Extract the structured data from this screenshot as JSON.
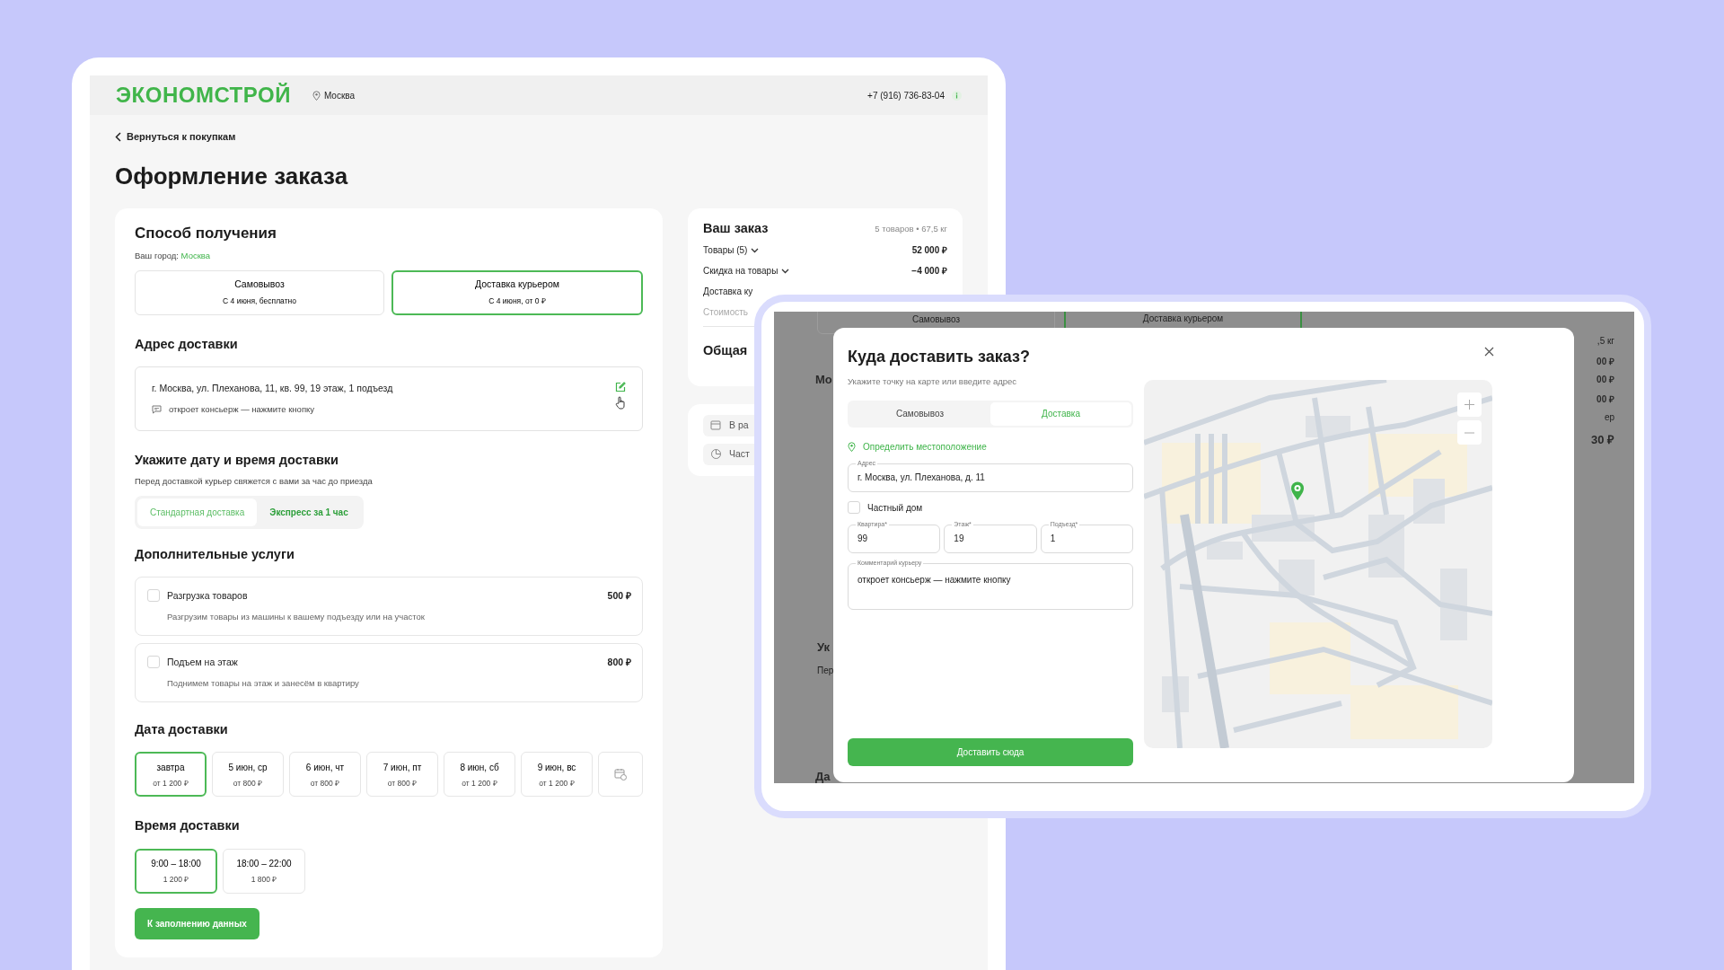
{
  "header": {
    "logo": "ЭКОНОМСТРОЙ",
    "city": "Москва",
    "phone": "+7 (916) 736-83-04"
  },
  "back_link": "Вернуться к покупкам",
  "page_title": "Оформление заказа",
  "receipt": {
    "title": "Способ получения",
    "city_label": "Ваш город:",
    "city": "Москва",
    "options": [
      {
        "title": "Самовывоз",
        "subtitle": "С 4 июня, бесплатно",
        "selected": false
      },
      {
        "title": "Доставка курьером",
        "subtitle": "С 4 июня, от 0 ₽",
        "selected": true
      }
    ]
  },
  "address": {
    "title": "Адрес доставки",
    "value": "г. Москва, ул. Плеханова, 11, кв. 99, 19 этаж, 1 подъезд",
    "comment": "откроет консьерж — нажмите кнопку"
  },
  "schedule": {
    "title": "Укажите дату и время доставки",
    "subtitle": "Перед доставкой курьер свяжется с вами за час до приезда",
    "modes": [
      {
        "label": "Стандартная доставка",
        "selected": true
      },
      {
        "label": "Экспресс за 1 час",
        "selected": false
      }
    ]
  },
  "services": {
    "title": "Дополнительные услуги",
    "items": [
      {
        "name": "Разгрузка товаров",
        "description": "Разгрузим товары из машины к вашему подъезду или на участок",
        "price": "500 ₽",
        "checked": false
      },
      {
        "name": "Подъем на этаж",
        "description": "Поднимем товары на этаж и занесём в квартиру",
        "price": "800 ₽",
        "checked": false
      }
    ]
  },
  "dates": {
    "title": "Дата доставки",
    "items": [
      {
        "day": "завтра",
        "price": "от 1 200 ₽",
        "selected": true
      },
      {
        "day": "5 июн, ср",
        "price": "от 800 ₽",
        "selected": false
      },
      {
        "day": "6 июн, чт",
        "price": "от 800 ₽",
        "selected": false
      },
      {
        "day": "7 июн, пт",
        "price": "от 800 ₽",
        "selected": false
      },
      {
        "day": "8 июн, сб",
        "price": "от 1 200 ₽",
        "selected": false
      },
      {
        "day": "9 июн, вс",
        "price": "от 1 200 ₽",
        "selected": false
      }
    ]
  },
  "times": {
    "title": "Время доставки",
    "items": [
      {
        "range": "9:00 – 18:00",
        "price": "1 200 ₽",
        "selected": true
      },
      {
        "range": "18:00 – 22:00",
        "price": "1 800 ₽",
        "selected": false
      }
    ]
  },
  "next_button": "К заполнению данных",
  "summary": {
    "title": "Ваш заказ",
    "meta": "5 товаров • 67,5 кг",
    "rows": [
      {
        "label": "Товары (5)",
        "value": "52 000 ₽",
        "expandable": true,
        "muted": false
      },
      {
        "label": "Скидка на товары",
        "value": "−4 000 ₽",
        "expandable": true,
        "muted": false
      },
      {
        "label": "Доставка ку",
        "expandable": false,
        "muted": false
      },
      {
        "label": "Стоимость",
        "expandable": false,
        "muted": true
      }
    ],
    "total_label": "Общая"
  },
  "extras": [
    {
      "kind": "calendar",
      "label": "В ра"
    },
    {
      "kind": "chart",
      "label": "Част"
    }
  ],
  "backdrop": {
    "texts": [
      {
        "kind": "option",
        "text": "Самовывоз",
        "selected": false
      },
      {
        "kind": "option",
        "text": "Доставка курьером",
        "selected": true
      },
      {
        "kind": "heading",
        "text": "Мо"
      },
      {
        "kind": "heading",
        "text": "Ук"
      },
      {
        "kind": "note",
        "text": "Пер"
      },
      {
        "kind": "heading",
        "text": "Да"
      },
      {
        "kind": "note",
        "text": ",5 кг"
      },
      {
        "kind": "value",
        "text": "00 ₽"
      },
      {
        "kind": "value",
        "text": "00 ₽"
      },
      {
        "kind": "value",
        "text": "00 ₽"
      },
      {
        "kind": "note",
        "text": "ер"
      },
      {
        "kind": "total",
        "text": "30 ₽"
      }
    ]
  },
  "modal": {
    "title": "Куда доставить заказ?",
    "subtitle": "Укажите точку на карте или введите адрес",
    "tabs": [
      {
        "label": "Самовывоз",
        "selected": false
      },
      {
        "label": "Доставка",
        "selected": true
      }
    ],
    "locate": "Определить местоположение",
    "address": {
      "label": "Адрес",
      "value": "г. Москва, ул. Плеханова, д. 11"
    },
    "private_house": {
      "label": "Частный дом",
      "checked": false
    },
    "fields": [
      {
        "label": "Квартира*",
        "value": "99"
      },
      {
        "label": "Этаж*",
        "value": "19"
      },
      {
        "label": "Подъезд*",
        "value": "1"
      }
    ],
    "comment": {
      "label": "Комментарий курьеру",
      "value": "откроет консьерж — нажмите кнопку"
    },
    "submit": "Доставить сюда"
  }
}
